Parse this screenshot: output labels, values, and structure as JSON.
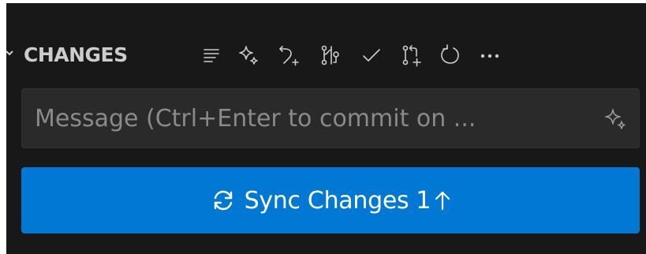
{
  "section": {
    "title": "CHANGES",
    "actions": [
      {
        "icon": "list-flat-icon"
      },
      {
        "icon": "sparkle-icon"
      },
      {
        "icon": "discard-icon"
      },
      {
        "icon": "stash-icon"
      },
      {
        "icon": "check-icon"
      },
      {
        "icon": "pull-request-create-icon"
      },
      {
        "icon": "refresh-icon"
      },
      {
        "icon": "ellipsis-icon"
      }
    ]
  },
  "commit_input": {
    "placeholder": "Message (Ctrl+Enter to commit on ...",
    "value": "",
    "trailing_icon": "sparkle-icon"
  },
  "sync_button": {
    "icon": "sync-icon",
    "label": "Sync Changes",
    "count": "1",
    "count_icon": "arrow-up-icon"
  },
  "colors": {
    "panel_bg": "#181818",
    "input_bg": "#2a2a2a",
    "button_bg": "#0078d4",
    "text": "#cccccc",
    "placeholder": "#8a8a8a"
  }
}
